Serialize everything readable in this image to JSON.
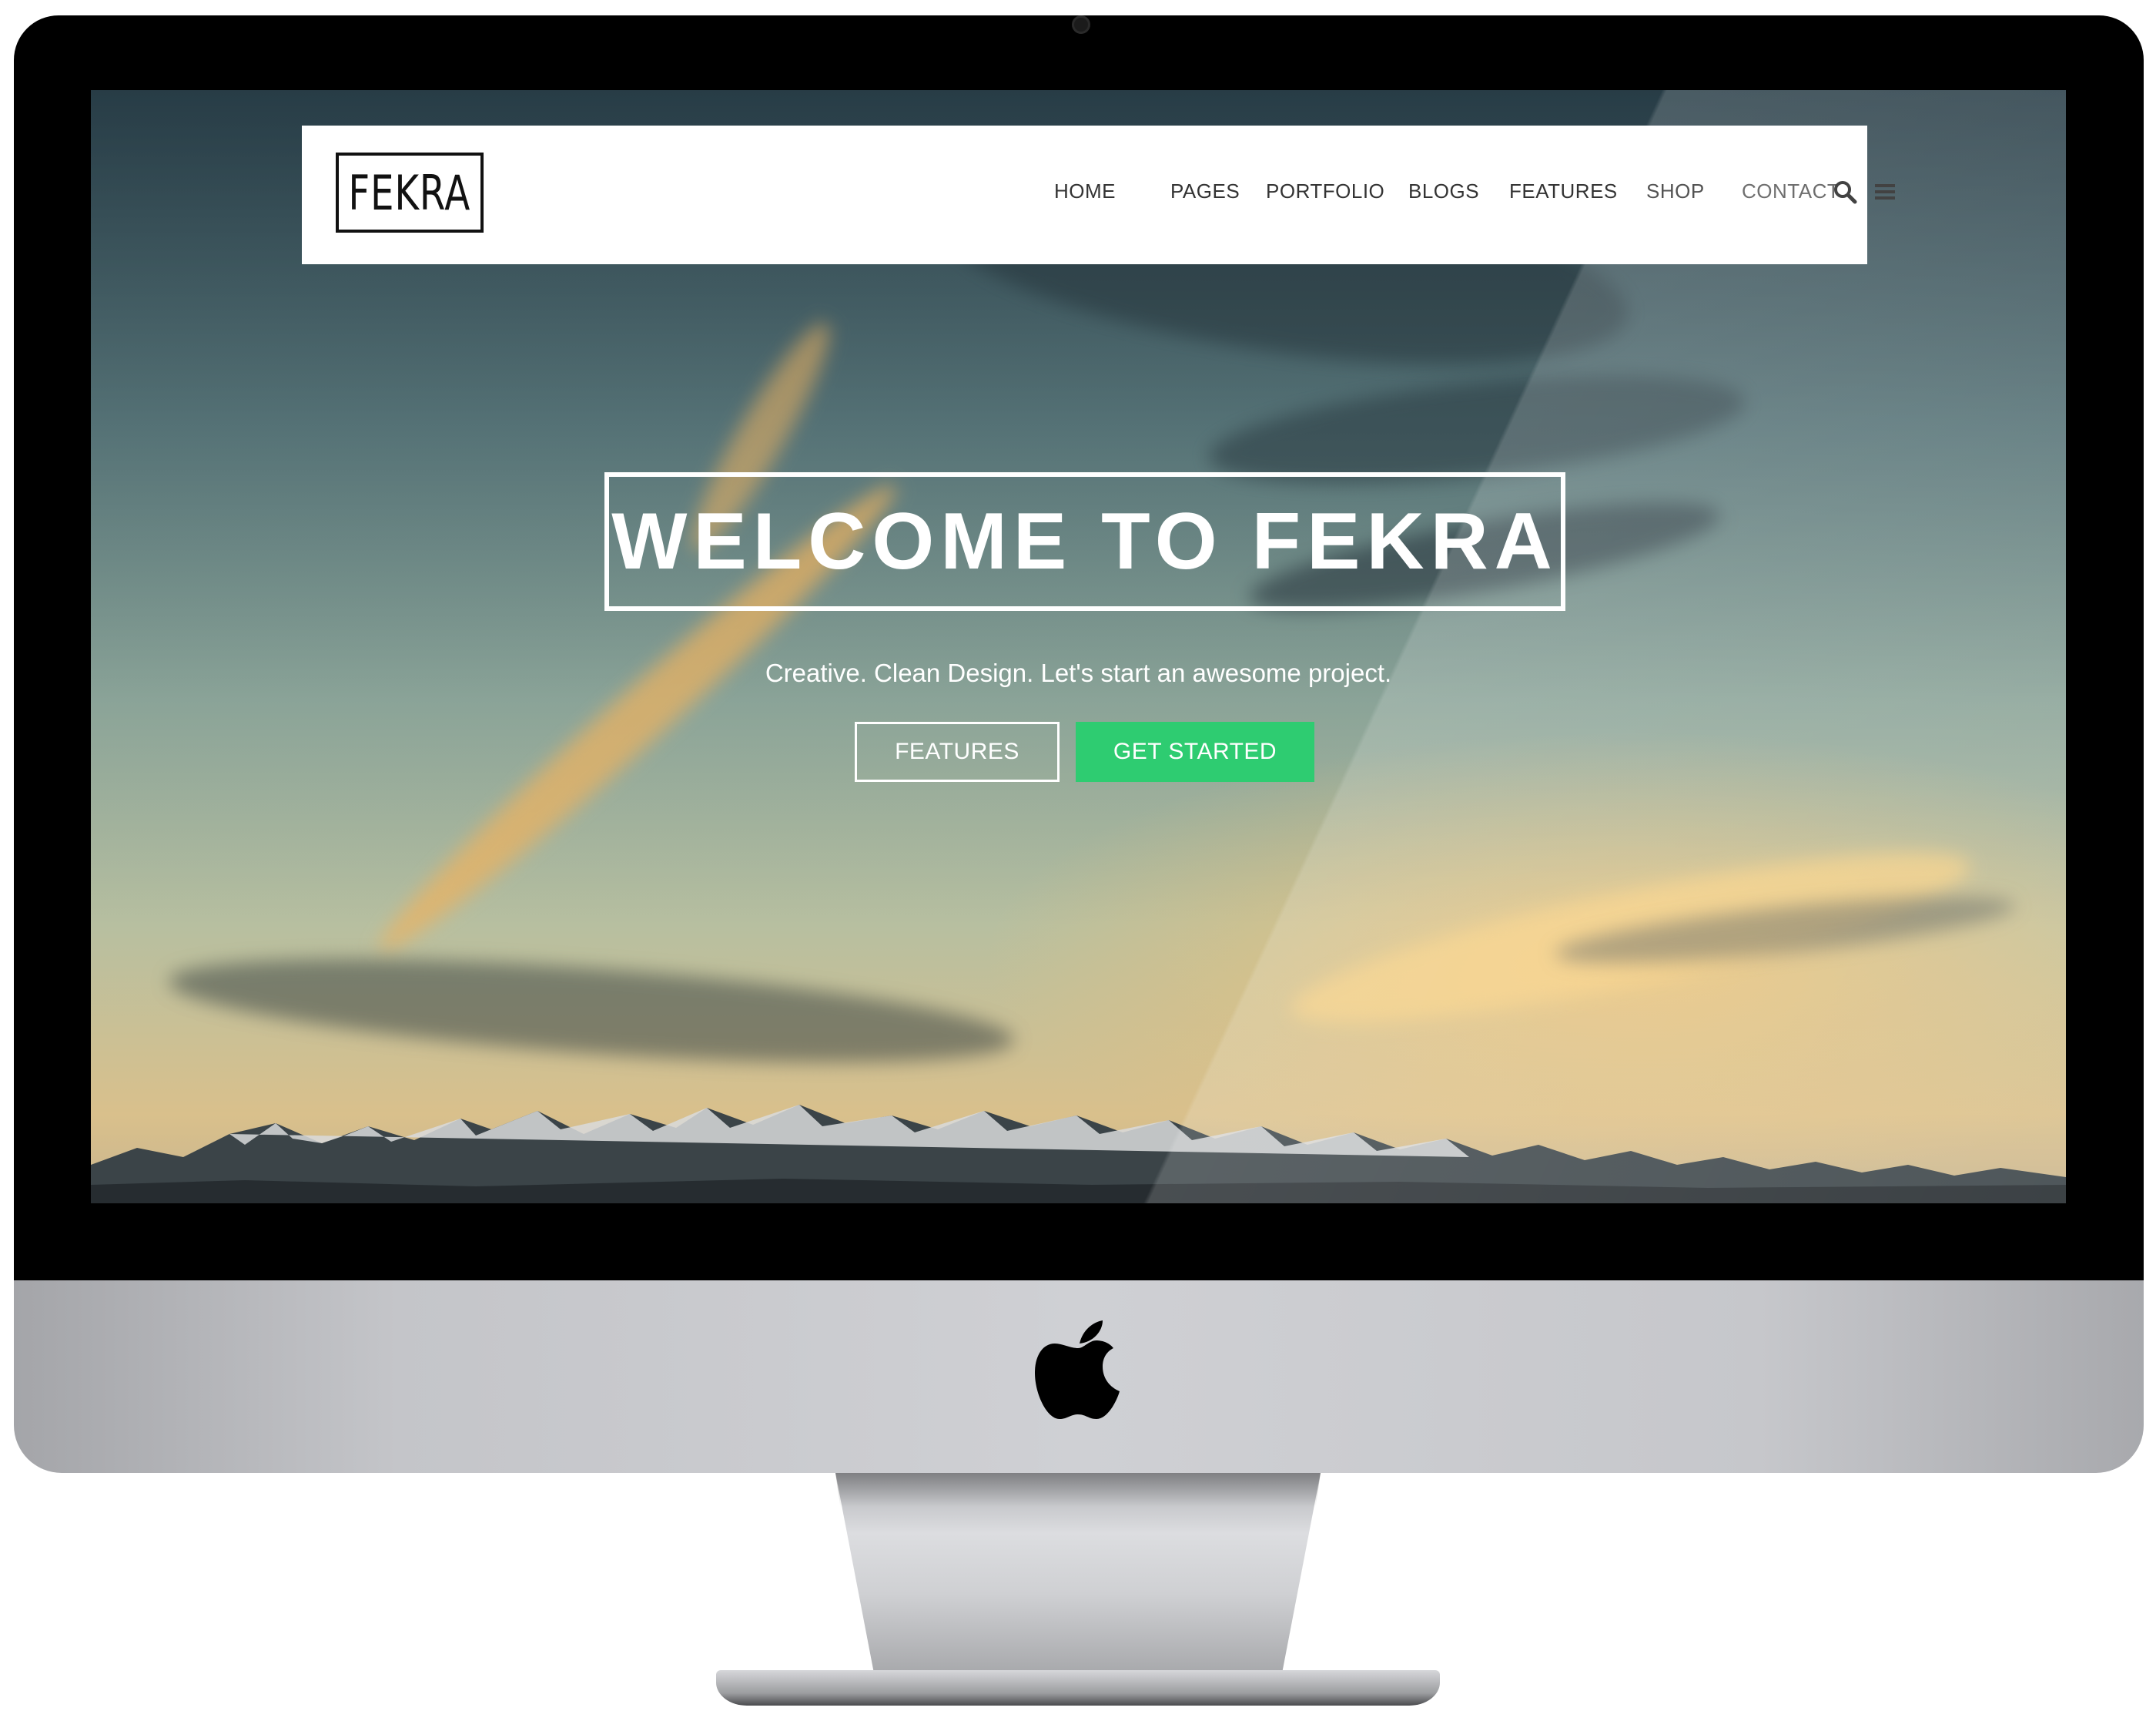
{
  "logo": {
    "text": "FEKRA"
  },
  "nav": {
    "items": [
      "HOME",
      "PAGES",
      "PORTFOLIO",
      "BLOGS",
      "FEATURES",
      "SHOP",
      "CONTACT"
    ],
    "search_icon": "search-icon",
    "menu_icon": "hamburger-menu-icon"
  },
  "hero": {
    "title": "WELCOME TO FEKRA",
    "subtitle": "Creative. Clean Design. Let's start an awesome project.",
    "features_button": "FEATURES",
    "get_started_button": "GET STARTED"
  },
  "colors": {
    "accent_green": "#2ecc71",
    "nav_bg": "#ffffff",
    "text_dark": "#333333"
  }
}
